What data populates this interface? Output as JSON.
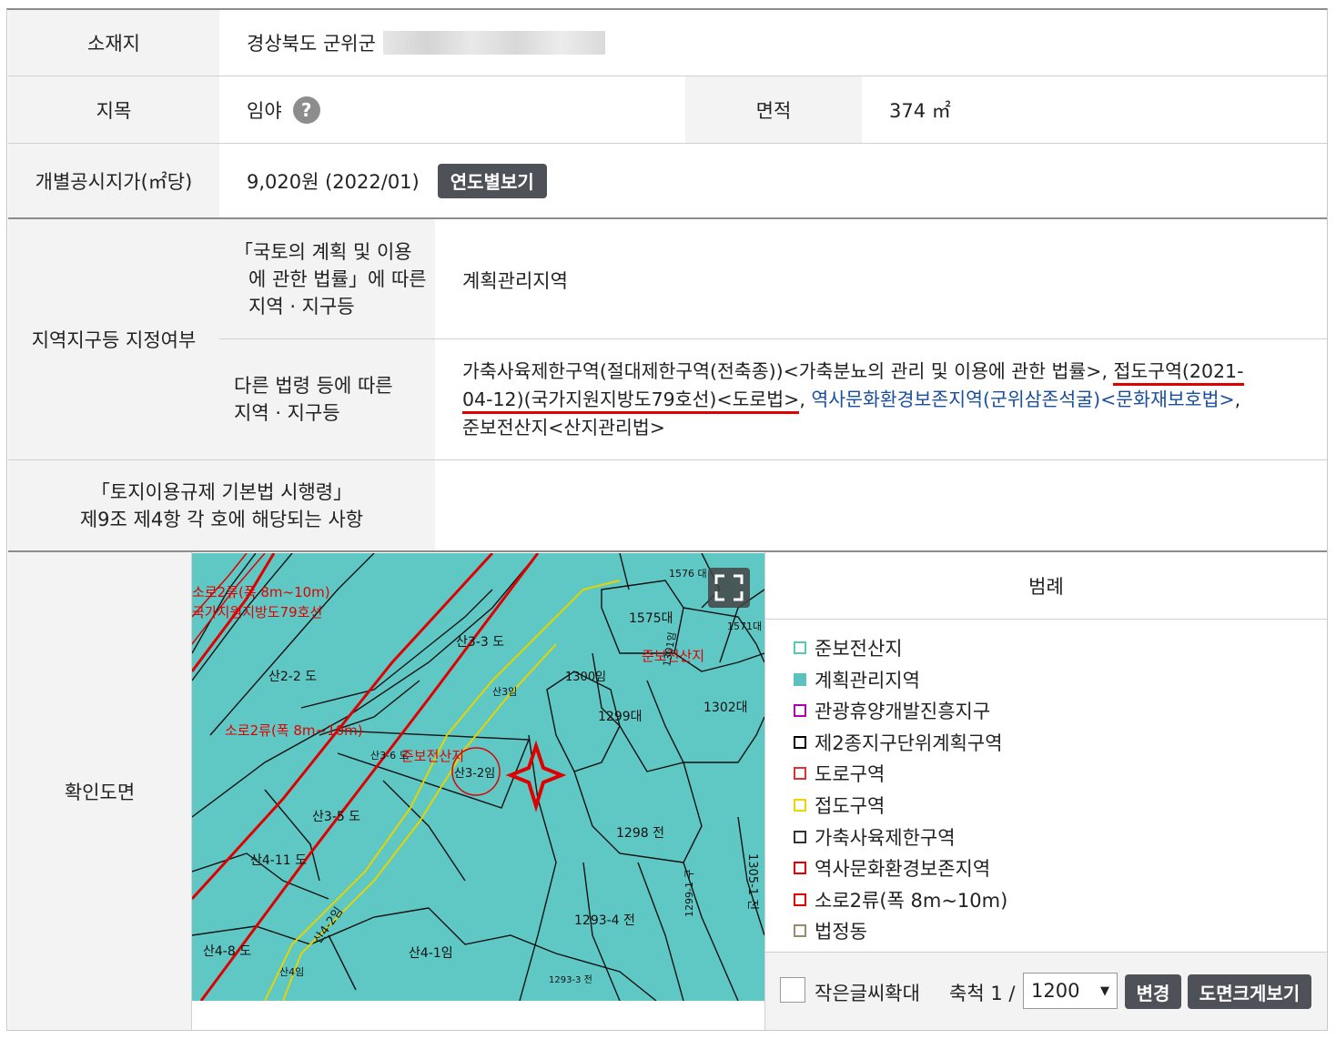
{
  "location": {
    "label": "소재지",
    "value": "경상북도 군위군"
  },
  "land_category": {
    "label": "지목",
    "value": "임야",
    "help_icon": "?"
  },
  "area": {
    "label": "면적",
    "value": "374 ㎡"
  },
  "official_price": {
    "label": "개별공시지가(㎡당)",
    "value": "9,020원 (2022/01)",
    "button": "연도별보기"
  },
  "zoning": {
    "label": "지역지구등 지정여부",
    "national_law_label_line1": "「국토의 계획 및 이용",
    "national_law_label_line2": "에 관한 법률」에 따른",
    "national_law_label_line3": "지역 · 지구등",
    "national_law_value": "계획관리지역",
    "other_law_label_line1": "다른 법령 등에 따른",
    "other_law_label_line2": "지역 · 지구등",
    "other_law_part1": "가축사육제한구역(절대제한구역(전축종))<가축분뇨의 관리 및 이용에 관한 법률>, ",
    "other_law_part2a": "접도구역(2021-",
    "other_law_part2b": "04-12)(국가지원지방도79호선)<도로법>",
    "other_law_part3": ", ",
    "other_law_part4": "역사문화환경보존지역(군위삼존석굴)<문화재보호법>",
    "other_law_part5": ",",
    "other_law_part6": "준보전산지<산지관리법>"
  },
  "basic_act": {
    "label_line1": "「토지이용규제 기본법 시행령」",
    "label_line2": "제9조 제4항 각 호에 해당되는 사항",
    "value": ""
  },
  "map_section": {
    "label": "확인도면",
    "fullscreen_icon": "expand-icon",
    "map_labels": {
      "road_width": "소로2류(폭 8m~10m)",
      "road_width_top": "소로2류(폭 8m~10m)",
      "route": "국가지원지방도79호선",
      "semi_forest": "준보전산지",
      "semi_forest_2": "준보전산지",
      "p_1576": "1576 대",
      "p_1575": "1575대",
      "p_1571": "1571대",
      "p_san33": "산3-3 도",
      "p_san22": "산2-2 도",
      "p_san3": "산3임",
      "p_1300": "1300임",
      "p_1301": "1301임",
      "p_1299": "1299대",
      "p_1302": "1302대",
      "p_san36": "산3-6 도",
      "p_san32": "산3-2임",
      "p_san35": "산3-5 도",
      "p_1298": "1298 전",
      "p_san411": "산4-11 도",
      "p_san42": "산4-2임",
      "p_1305": "1305-1 전",
      "p_1293": "1293-4 전",
      "p_san48": "산4-8 도",
      "p_san41": "산4-1임",
      "p_san4": "산4임",
      "p_12933": "1293-3 전",
      "p_1299v": "1299-1 구"
    }
  },
  "legend": {
    "title": "범례",
    "items": [
      {
        "label": "준보전산지",
        "color": "#58c9b4",
        "filled": false
      },
      {
        "label": "계획관리지역",
        "color": "#5bc2c0",
        "filled": true
      },
      {
        "label": "관광휴양개발진흥지구",
        "color": "#b000b0",
        "filled": false
      },
      {
        "label": "제2종지구단위계획구역",
        "color": "#000000",
        "filled": false
      },
      {
        "label": "도로구역",
        "color": "#e03030",
        "filled": false
      },
      {
        "label": "접도구역",
        "color": "#e8d800",
        "filled": false
      },
      {
        "label": "가축사육제한구역",
        "color": "#333333",
        "filled": false
      },
      {
        "label": "역사문화환경보존지역",
        "color": "#e00000",
        "filled": false
      },
      {
        "label": "소로2류(폭 8m~10m)",
        "color": "#e00000",
        "filled": false
      },
      {
        "label": "법정동",
        "color": "#9a8a6a",
        "filled": false
      }
    ]
  },
  "controls": {
    "enlarge_label": "작은글씨확대",
    "scale_label": "축척 1 /",
    "scale_value": "1200",
    "change_button": "변경",
    "large_view_button": "도면크게보기"
  },
  "colors": {
    "map_fill": "#5fc8c5",
    "header_bg": "#f3f3f3",
    "button_dark": "#4f5158",
    "underline_red": "#e00000",
    "link_blue": "#1a4fa0"
  }
}
